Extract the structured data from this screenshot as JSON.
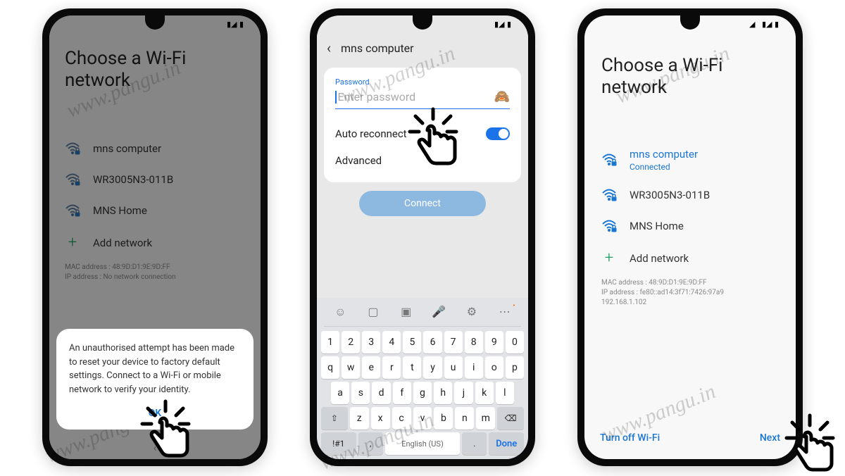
{
  "watermark": "www.pangu.in",
  "screen1": {
    "title": "Choose a Wi-Fi network",
    "networks": [
      {
        "name": "mns computer"
      },
      {
        "name": "WR3005N3-011B"
      },
      {
        "name": "MNS Home"
      }
    ],
    "add_network": "Add network",
    "mac_line": "MAC address : 48:9D:D1:9E:9D:FF",
    "ip_line": "IP address : No network connection",
    "popup_text": "An unauthorised attempt has been made to reset your device to factory default settings. Connect to a Wi-Fi or mobile network to verify your identity.",
    "popup_ok": "OK"
  },
  "screen2": {
    "header": "mns computer",
    "password_label": "Password",
    "password_placeholder": "Enter password",
    "auto_reconnect": "Auto reconnect",
    "advanced": "Advanced",
    "connect": "Connect",
    "keyboard": {
      "row_num": [
        "1",
        "2",
        "3",
        "4",
        "5",
        "6",
        "7",
        "8",
        "9",
        "0"
      ],
      "row1": [
        "q",
        "w",
        "e",
        "r",
        "t",
        "y",
        "u",
        "i",
        "o",
        "p"
      ],
      "row2": [
        "a",
        "s",
        "d",
        "f",
        "g",
        "h",
        "j",
        "k",
        "l"
      ],
      "row3_shift": "⇧",
      "row3": [
        "z",
        "x",
        "c",
        "v",
        "b",
        "n",
        "m"
      ],
      "row3_del": "⌫",
      "sym": "!#1",
      "comma": ",",
      "space": "English (US)",
      "period": ".",
      "done": "Done"
    }
  },
  "screen3": {
    "title": "Choose a Wi-Fi network",
    "networks": [
      {
        "name": "mns computer",
        "status": "Connected"
      },
      {
        "name": "WR3005N3-011B"
      },
      {
        "name": "MNS Home"
      }
    ],
    "add_network": "Add network",
    "mac_line": "MAC address : 48:9D:D1:9E:9D:FF",
    "ip_line1": "IP address : fe80::ad14:3f71:7426:97a9",
    "ip_line2": "192.168.1.102",
    "turn_off": "Turn off Wi-Fi",
    "next": "Next"
  }
}
